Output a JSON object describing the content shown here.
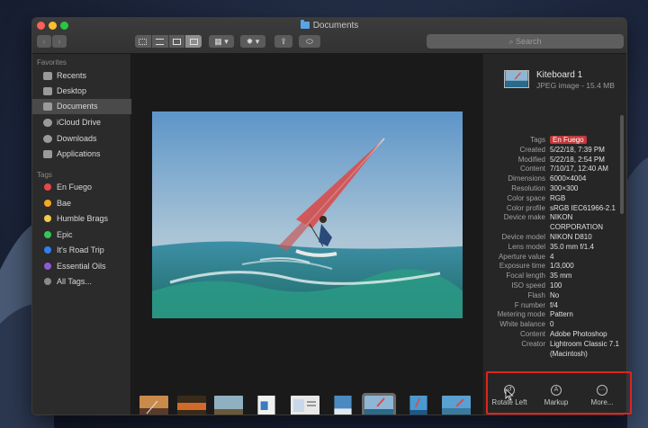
{
  "window": {
    "title": "Documents"
  },
  "toolbar": {
    "back": "‹",
    "forward": "›",
    "search_placeholder": "Search"
  },
  "sidebar": {
    "favorites_heading": "Favorites",
    "favorites": [
      {
        "label": "Recents",
        "icon": "clock-icon"
      },
      {
        "label": "Desktop",
        "icon": "desktop-icon"
      },
      {
        "label": "Documents",
        "icon": "documents-icon",
        "selected": true
      },
      {
        "label": "iCloud Drive",
        "icon": "cloud-icon"
      },
      {
        "label": "Downloads",
        "icon": "downloads-icon"
      },
      {
        "label": "Applications",
        "icon": "applications-icon"
      }
    ],
    "tags_heading": "Tags",
    "tags": [
      {
        "label": "En Fuego",
        "color": "#e5484d"
      },
      {
        "label": "Bae",
        "color": "#f5a623"
      },
      {
        "label": "Humble Brags",
        "color": "#f2c94c"
      },
      {
        "label": "Epic",
        "color": "#34c759"
      },
      {
        "label": "It's Road Trip",
        "color": "#2f80ed"
      },
      {
        "label": "Essential Oils",
        "color": "#8e5bd6"
      },
      {
        "label": "All Tags...",
        "color": "#8a8a8a"
      }
    ]
  },
  "inspector": {
    "file_name": "Kiteboard 1",
    "file_info": "JPEG image - 15.4 MB",
    "metadata": [
      {
        "label": "Tags",
        "value": "En Fuego",
        "chip": true
      },
      {
        "label": "Created",
        "value": "5/22/18, 7:39 PM"
      },
      {
        "label": "Modified",
        "value": "5/22/18, 2:54 PM"
      },
      {
        "label": "Content",
        "value": "7/10/17, 12:40 AM"
      },
      {
        "label": "Dimensions",
        "value": "6000×4004"
      },
      {
        "label": "Resolution",
        "value": "300×300"
      },
      {
        "label": "Color space",
        "value": "RGB"
      },
      {
        "label": "Color profile",
        "value": "sRGB IEC61966-2.1"
      },
      {
        "label": "Device make",
        "value": "NIKON"
      },
      {
        "label": "",
        "value": "CORPORATION"
      },
      {
        "label": "Device model",
        "value": "NIKON D810"
      },
      {
        "label": "Lens model",
        "value": "35.0 mm f/1.4"
      },
      {
        "label": "Aperture value",
        "value": "4"
      },
      {
        "label": "Exposure time",
        "value": "1/3,000"
      },
      {
        "label": "Focal length",
        "value": "35 mm"
      },
      {
        "label": "ISO speed",
        "value": "100"
      },
      {
        "label": "Flash",
        "value": "No"
      },
      {
        "label": "F number",
        "value": "f/4"
      },
      {
        "label": "Metering mode",
        "value": "Pattern"
      },
      {
        "label": "White balance",
        "value": "0"
      },
      {
        "label": "Content",
        "value": "Adobe Photoshop"
      },
      {
        "label": "Creator",
        "value": "Lightroom Classic 7.1"
      },
      {
        "label": "",
        "value": "(Macintosh)"
      }
    ],
    "actions": [
      {
        "label": "Rotate Left",
        "icon": "rotate-left-icon",
        "glyph": "↺"
      },
      {
        "label": "Markup",
        "icon": "markup-icon",
        "glyph": "A"
      },
      {
        "label": "More...",
        "icon": "more-icon",
        "glyph": "···"
      }
    ]
  },
  "thumbnails": [
    {
      "name": "sunset-kite",
      "colors": [
        "#c98a4a",
        "#5a3a2a"
      ]
    },
    {
      "name": "sunset-sea",
      "colors": [
        "#d26a2a",
        "#3a2a1a"
      ]
    },
    {
      "name": "beach",
      "colors": [
        "#8fb0c0",
        "#6a5a3a"
      ]
    },
    {
      "name": "poster",
      "colors": [
        "#f0f0f0",
        "#3a7ac0"
      ]
    },
    {
      "name": "document",
      "colors": [
        "#e8e8e8",
        "#c8d8e8"
      ]
    },
    {
      "name": "surf-1",
      "colors": [
        "#4a8ac0",
        "#e0e8f0"
      ]
    },
    {
      "name": "kiteboard-1",
      "colors": [
        "#3a7ab0",
        "#2a6a8a"
      ],
      "selected": true
    },
    {
      "name": "kite-vertical",
      "colors": [
        "#4a9ad0",
        "#1a5a8a"
      ]
    },
    {
      "name": "surf-2",
      "colors": [
        "#5aa0d0",
        "#3a7aa0"
      ]
    }
  ]
}
